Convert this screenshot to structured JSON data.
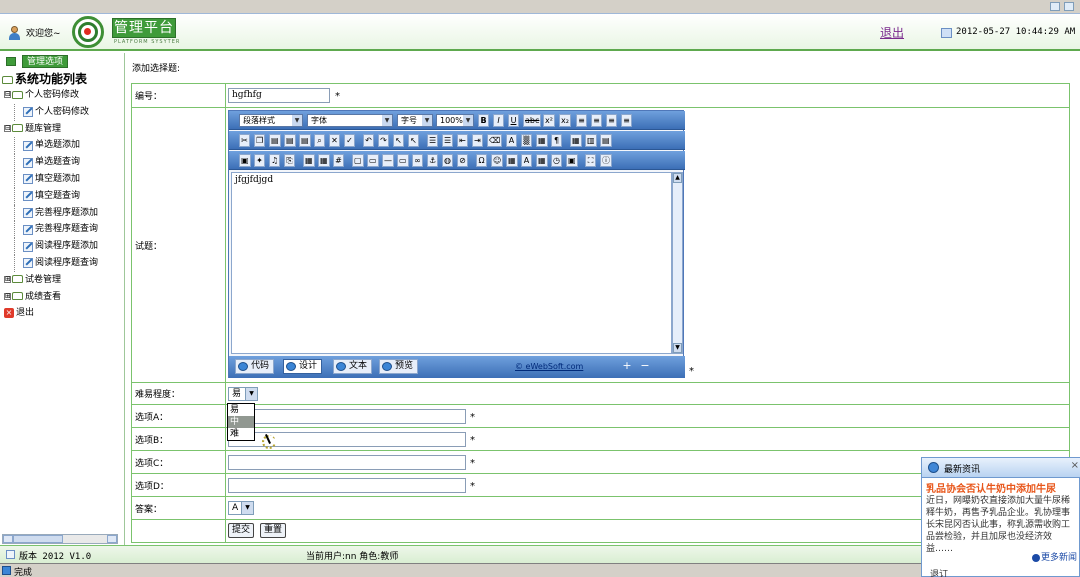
{
  "header": {
    "welcome": "欢迎您~",
    "brand": "管理平台",
    "brand_sub": "PLATFORM SYSYTER",
    "logout": "退出",
    "datetime": "2012-05-27 10:44:29 AM"
  },
  "sidebar": {
    "header_label": "管理选项",
    "root": "系统功能列表",
    "items": [
      {
        "label": "个人密码修改",
        "level": 1,
        "kind": "folder",
        "expander": "⊟"
      },
      {
        "label": "个人密码修改",
        "level": 2,
        "kind": "page"
      },
      {
        "label": "题库管理",
        "level": 1,
        "kind": "folder",
        "expander": "⊟"
      },
      {
        "label": "单选题添加",
        "level": 2,
        "kind": "page"
      },
      {
        "label": "单选题查询",
        "level": 2,
        "kind": "page"
      },
      {
        "label": "填空题添加",
        "level": 2,
        "kind": "page"
      },
      {
        "label": "填空题查询",
        "level": 2,
        "kind": "page"
      },
      {
        "label": "完善程序题添加",
        "level": 2,
        "kind": "page"
      },
      {
        "label": "完善程序题查询",
        "level": 2,
        "kind": "page"
      },
      {
        "label": "阅读程序题添加",
        "level": 2,
        "kind": "page"
      },
      {
        "label": "阅读程序题查询",
        "level": 2,
        "kind": "page"
      },
      {
        "label": "试卷管理",
        "level": 1,
        "kind": "folder",
        "expander": "⊞"
      },
      {
        "label": "成绩查看",
        "level": 1,
        "kind": "folder",
        "expander": "⊞"
      },
      {
        "label": "退出",
        "level": 1,
        "kind": "exit"
      }
    ]
  },
  "main": {
    "title": "添加选择题:",
    "labels": {
      "number": "编号：",
      "question": "试题：",
      "difficulty": "难易程度：",
      "opt_a": "选项A：",
      "opt_b": "选项B：",
      "opt_c": "选项C：",
      "opt_d": "选项D：",
      "answer": "答案："
    },
    "number_value": "hgfhfg",
    "required_mark": "*",
    "editor": {
      "paragraph_style": "段落样式",
      "font": "字体",
      "font_size": "字号",
      "zoom": "100%",
      "content": "jfgjfdjgd",
      "modes": [
        "代码",
        "设计",
        "文本",
        "预览"
      ],
      "active_mode": "设计",
      "copyright": "© eWebSoft.com"
    },
    "difficulty": {
      "selected": "易",
      "options": [
        "易",
        "中",
        "难"
      ],
      "highlighted": "中"
    },
    "answer": {
      "selected": "A"
    },
    "buttons": {
      "submit": "提交",
      "reset": "重置"
    }
  },
  "footer": {
    "version": "版本 2012 V1.0",
    "current_user": "当前用户:nn  角色:教师"
  },
  "status": {
    "text": "完成"
  },
  "news": {
    "title": "最新资讯",
    "headline": "乳品协会否认牛奶中添加牛尿",
    "body": "近日，网曝奶农直接添加大量牛尿稀释牛奶，再售予乳品企业。乳协理事长宋昆冈否认此事，称乳源需收购工品尝检验，并且加尿也没经济效益……",
    "more": "更多新闻",
    "footer": "退订"
  }
}
